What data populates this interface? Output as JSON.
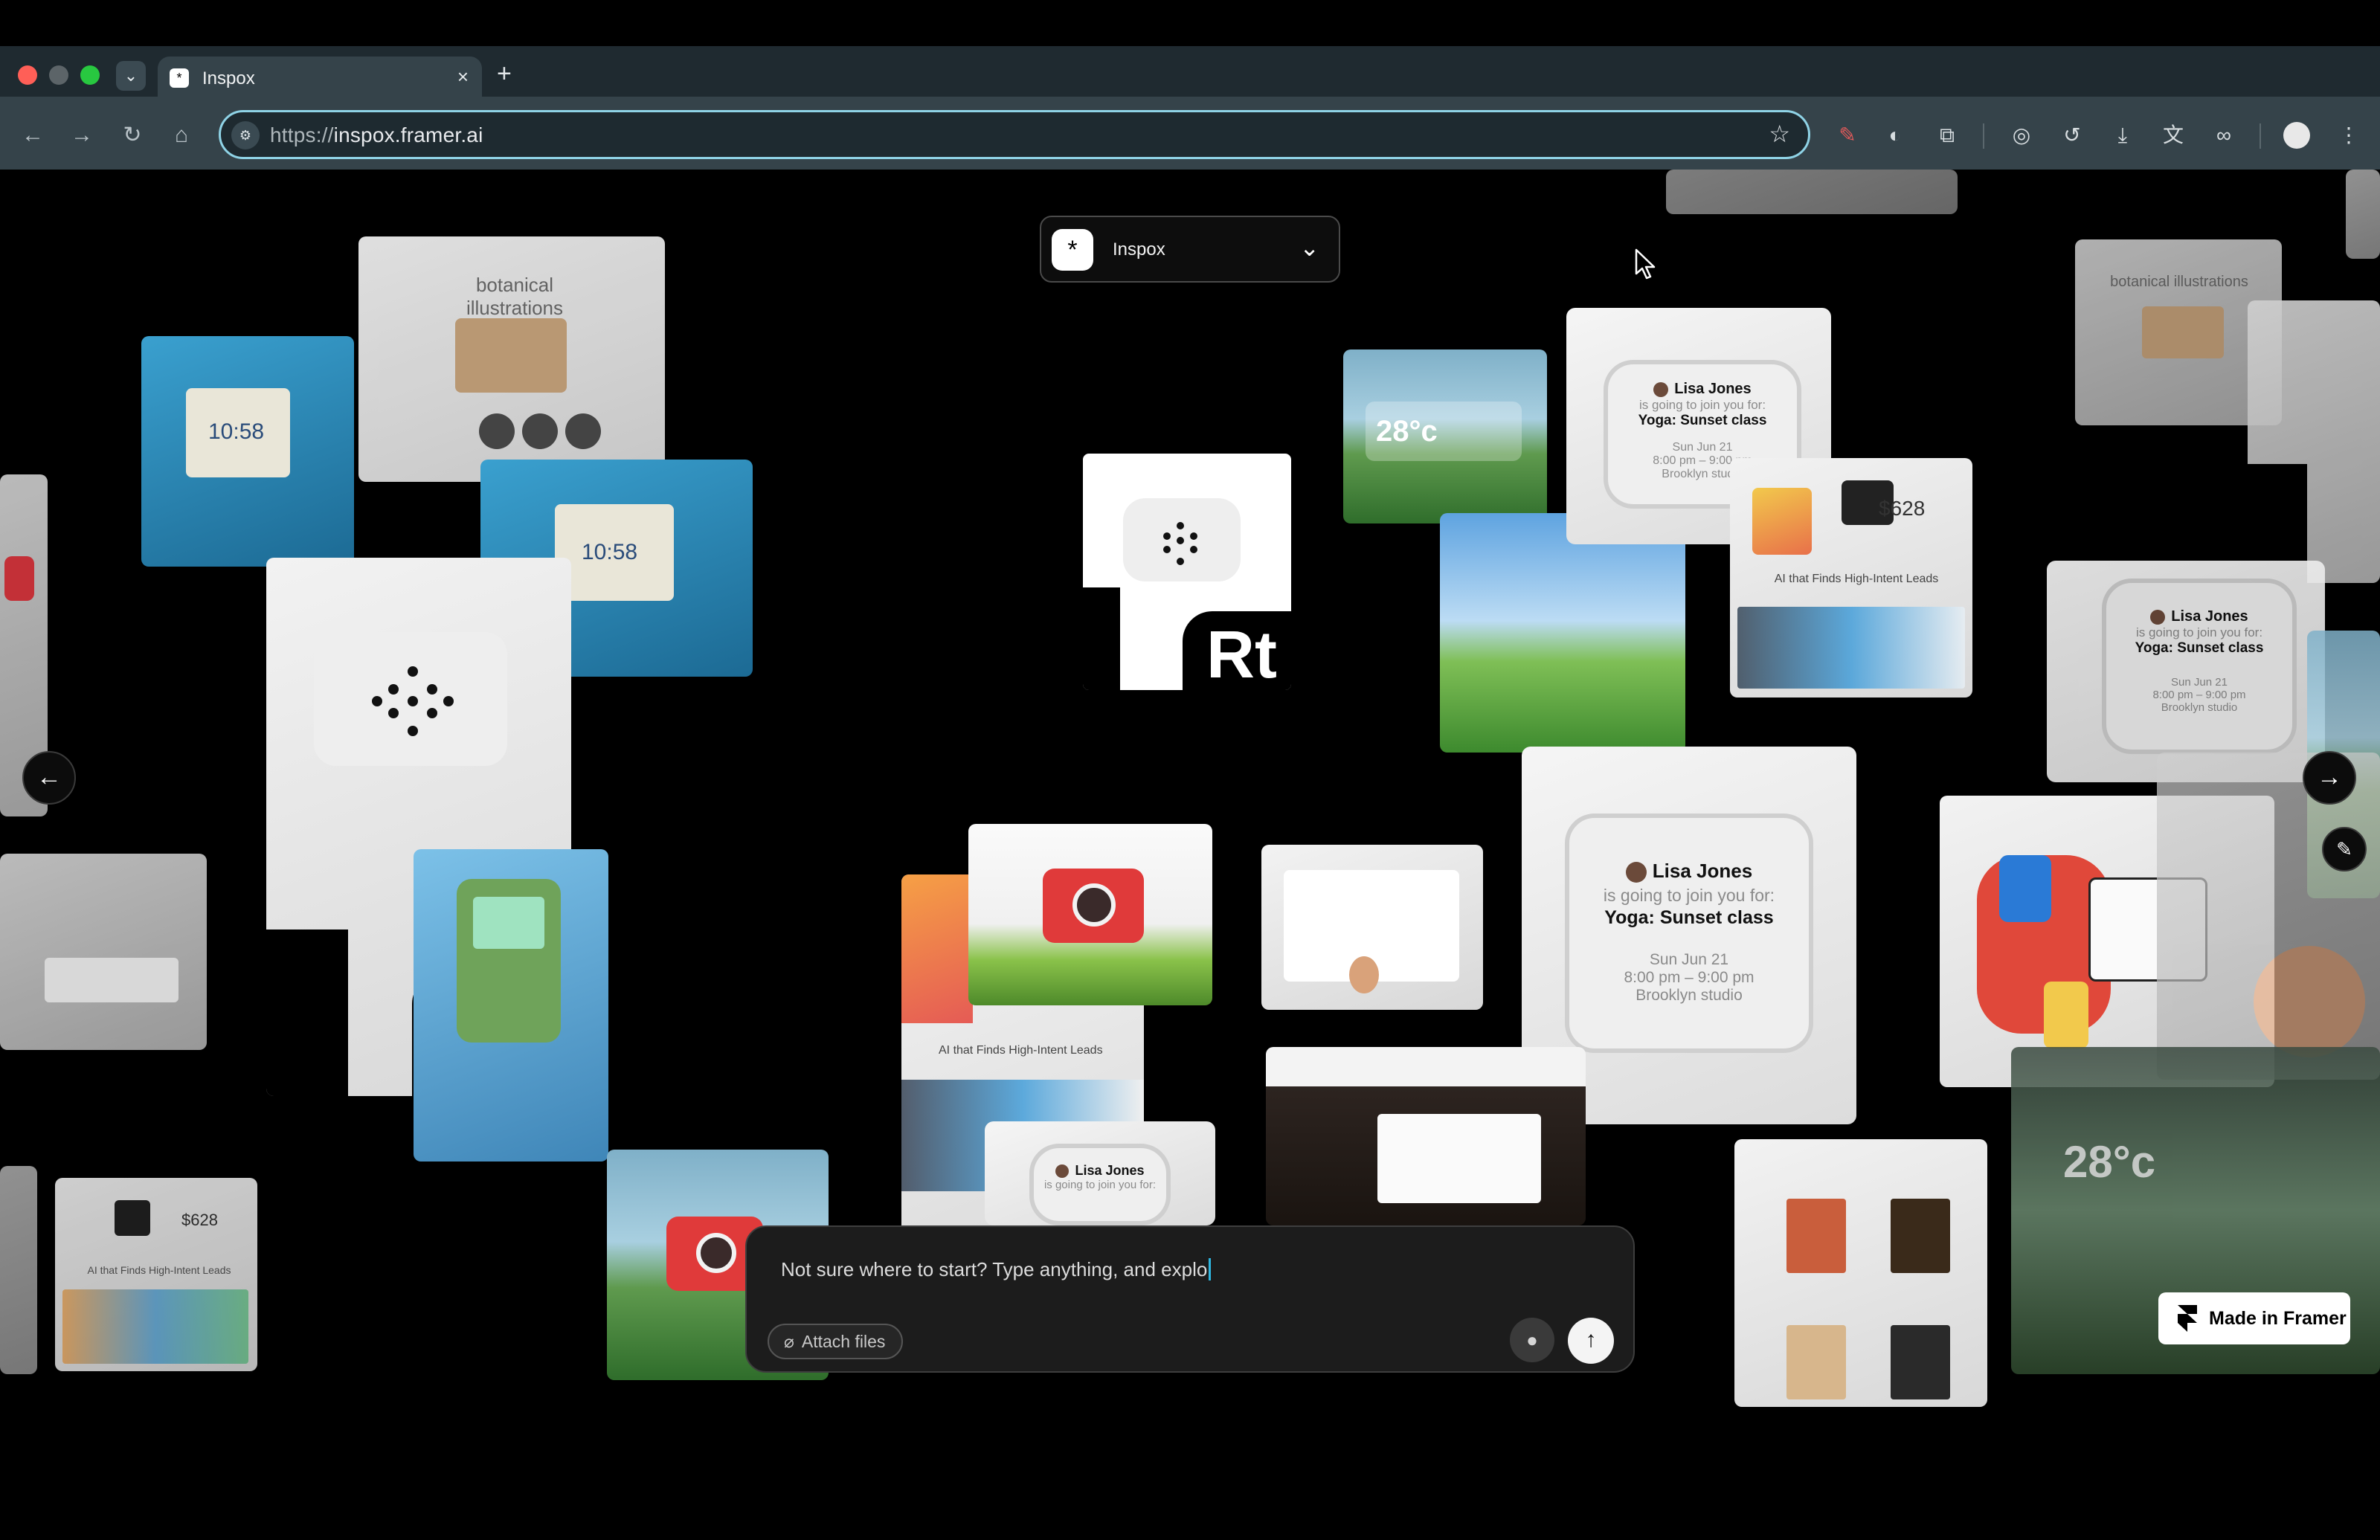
{
  "browser": {
    "tab_title": "Inspox",
    "tab_close": "×",
    "new_tab": "+",
    "url_scheme": "https://",
    "url_host": "inspox.framer.ai",
    "favicon": "*"
  },
  "app": {
    "selector_label": "Inspox",
    "logo_glyph": "*"
  },
  "nav": {
    "prev": "←",
    "next": "→"
  },
  "chat": {
    "placeholder_typed": "Not sure where to start? Type anything, and explo",
    "attach_label": "Attach files"
  },
  "badge": {
    "made_in_framer": "Made in Framer"
  },
  "cards": {
    "lisa_name": "Lisa Jones",
    "lisa_sub": "is going to join you for:",
    "lisa_class": "Yoga: Sunset class",
    "lisa_date": "Sun Jun 21",
    "lisa_time": "8:00 pm – 9:00 pm",
    "lisa_place": "Brooklyn studio",
    "rt": "Rt",
    "botanical": "botanical illustrations",
    "ai_leads": "AI that Finds High-Intent Leads",
    "price": "$628",
    "temp": "28°c",
    "clock": "10:58"
  },
  "colors": {
    "omnibox_focus": "#8fd3e6",
    "caret": "#2fb6e0"
  }
}
